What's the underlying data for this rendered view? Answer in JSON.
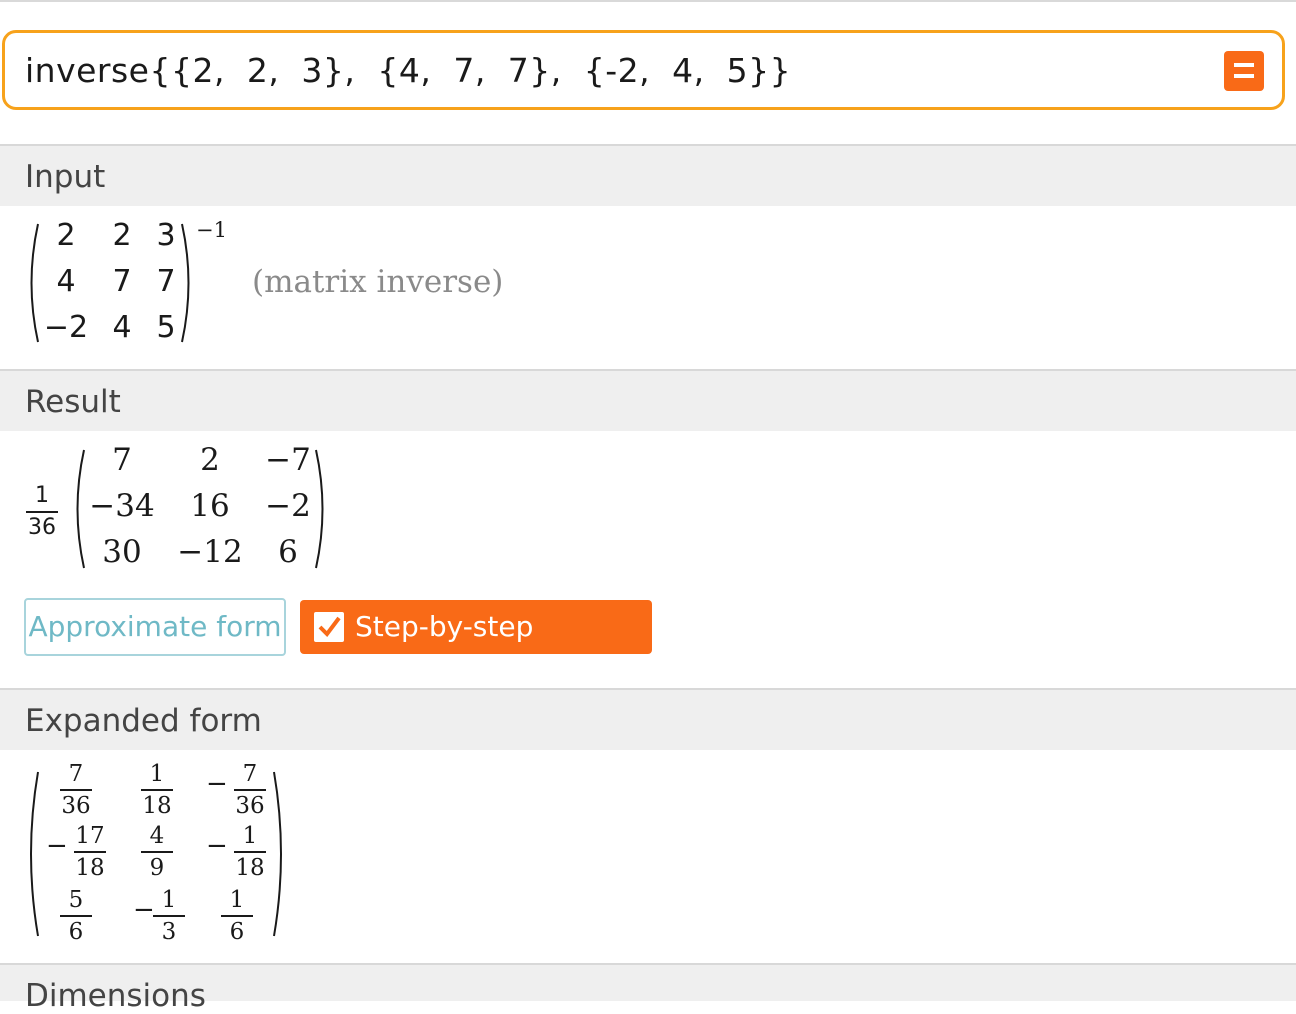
{
  "query": {
    "text": "inverse{{2,  2,  3},  {4,  7,  7},  {-2,  4,  5}}",
    "button_icon": "equal-icon",
    "accent": "#f96a17"
  },
  "input_pod": {
    "title": "Input",
    "matrix": [
      [
        "2",
        "2",
        "3"
      ],
      [
        "4",
        "7",
        "7"
      ],
      [
        "−2",
        "4",
        "5"
      ]
    ],
    "exponent": "−1",
    "note": "(matrix inverse)"
  },
  "result_pod": {
    "title": "Result",
    "scalar": {
      "num": "1",
      "den": "36"
    },
    "matrix": [
      [
        "7",
        "2",
        "−7"
      ],
      [
        "−34",
        "16",
        "−2"
      ],
      [
        "30",
        "−12",
        "6"
      ]
    ],
    "approx_button": "Approximate form",
    "step_button": "Step-by-step solution"
  },
  "expanded_pod": {
    "title": "Expanded form",
    "matrix": [
      [
        {
          "sign": "",
          "num": "7",
          "den": "36"
        },
        {
          "sign": "",
          "num": "1",
          "den": "18"
        },
        {
          "sign": "−",
          "num": "7",
          "den": "36"
        }
      ],
      [
        {
          "sign": "−",
          "num": "17",
          "den": "18"
        },
        {
          "sign": "",
          "num": "4",
          "den": "9"
        },
        {
          "sign": "−",
          "num": "1",
          "den": "18"
        }
      ],
      [
        {
          "sign": "",
          "num": "5",
          "den": "6"
        },
        {
          "sign": "−",
          "num": "1",
          "den": "3"
        },
        {
          "sign": "",
          "num": "1",
          "den": "6"
        }
      ]
    ]
  },
  "dimensions_pod": {
    "title": "Dimensions"
  },
  "colors": {
    "accent": "#f96a17",
    "query_border": "#f7a21b",
    "approx_text": "#6fb9c6",
    "header_bg": "#efefef"
  }
}
